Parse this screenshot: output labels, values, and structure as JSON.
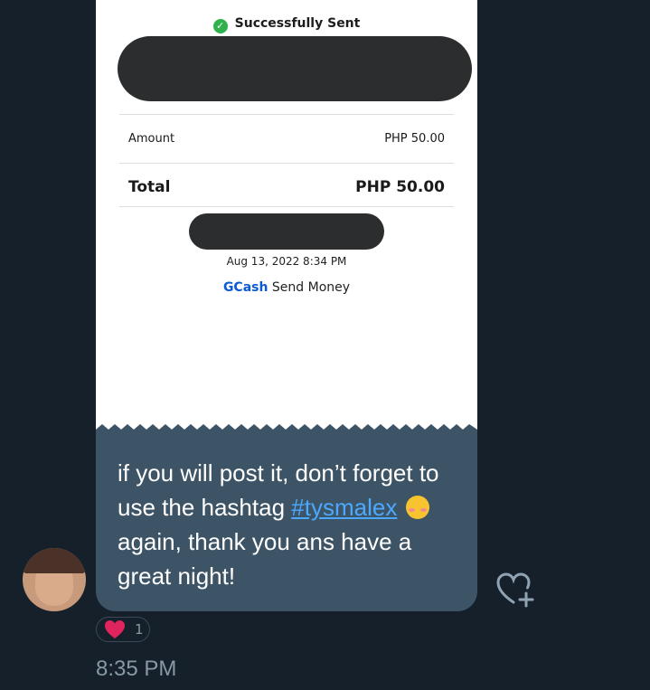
{
  "receipt": {
    "status": "Successfully Sent",
    "amount_label": "Amount",
    "amount_value": "PHP 50.00",
    "total_label": "Total",
    "total_value": "PHP 50.00",
    "datetime": "Aug 13, 2022 8:34 PM",
    "brand": "GCash",
    "service": "Send Money"
  },
  "message": {
    "text_1": "if you will post it, don’t forget to use the hashtag",
    "hashtag": "#tysmalex",
    "emoji": "smiling-face-with-blush",
    "text_2": "again, thank you ans have a great night!"
  },
  "reaction": {
    "icon": "heart-icon",
    "count": "1"
  },
  "timestamp": "8:35 PM",
  "colors": {
    "background": "#15202b",
    "bubble": "#3d5466",
    "hashtag": "#4ba8ff",
    "gcash_blue": "#0a5bd1",
    "check_green": "#2fb24b",
    "heart_red": "#e0245e"
  }
}
